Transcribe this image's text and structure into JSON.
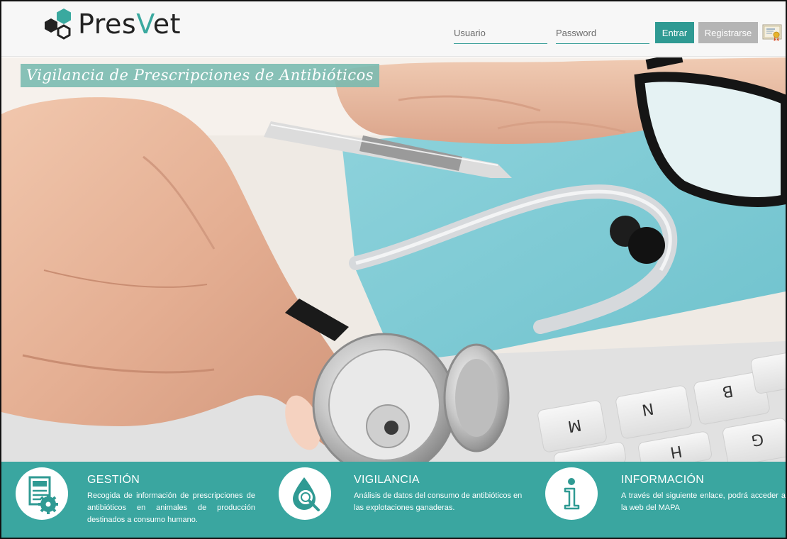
{
  "brand": {
    "name_part1": "Pres",
    "name_part2": "V",
    "name_part3": "et",
    "accent_color": "#3aa99f"
  },
  "login": {
    "username_placeholder": "Usuario",
    "password_placeholder": "Password",
    "enter_label": "Entrar",
    "register_label": "Registrarse",
    "certificate_icon": "certificate-icon"
  },
  "hero": {
    "title": "Vigilancia de Prescripciones de Antibióticos"
  },
  "features": [
    {
      "icon": "document-gear-icon",
      "title": "GESTIÓN",
      "text": "Recogida de información de prescripciones de antibióticos en animales de producción destinados a consumo humano."
    },
    {
      "icon": "drop-magnifier-icon",
      "title": "VIGILANCIA",
      "text": "Análisis de datos del consumo de antibióticos en las explotaciones ganaderas."
    },
    {
      "icon": "info-icon",
      "title": "INFORMACIÓN",
      "text": "A través del siguiente enlace, podrá acceder a la web del MAPA"
    }
  ],
  "colors": {
    "teal": "#3aa6a0",
    "button_enter": "#2f9a93",
    "button_register": "#b5b5b5"
  }
}
